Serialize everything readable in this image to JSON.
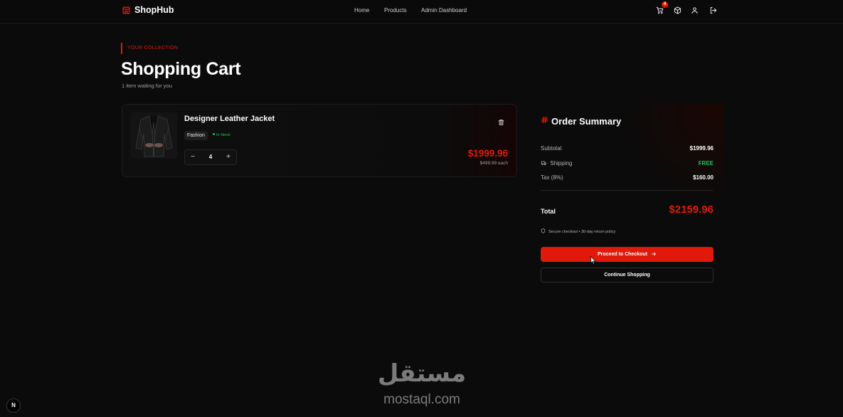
{
  "nav": {
    "brand": "ShopHub",
    "links": [
      "Home",
      "Products",
      "Admin Dashboard"
    ],
    "cart_count": "4",
    "icons": [
      "cart-icon",
      "package-icon",
      "user-icon",
      "logout-icon"
    ]
  },
  "header": {
    "eyebrow": "YOUR COLLECTION",
    "title": "Shopping Cart",
    "subtitle": "1 item waiting for you"
  },
  "cart": {
    "items": [
      {
        "name": "Designer Leather Jacket",
        "category": "Fashion",
        "stock": "In Stock",
        "quantity": "4",
        "total": "$1999.96",
        "each": "$499.99 each"
      }
    ]
  },
  "summary": {
    "title": "Order Summary",
    "subtotal_label": "Subtotal",
    "subtotal_value": "$1999.96",
    "shipping_label": "Shipping",
    "shipping_value": "FREE",
    "tax_label": "Tax (8%)",
    "tax_value": "$160.00",
    "total_label": "Total",
    "total_value": "$2159.96",
    "secure_note": "Secure checkout • 30-day return policy",
    "checkout_label": "Proceed to Checkout",
    "continue_label": "Continue Shopping"
  },
  "footer": {
    "dev_badge": "N",
    "watermark_ar": "مستقل",
    "watermark_en": "mostaql.com"
  },
  "colors": {
    "accent": "#e0190a",
    "success": "#22c55e",
    "background": "#0b0b0b"
  }
}
